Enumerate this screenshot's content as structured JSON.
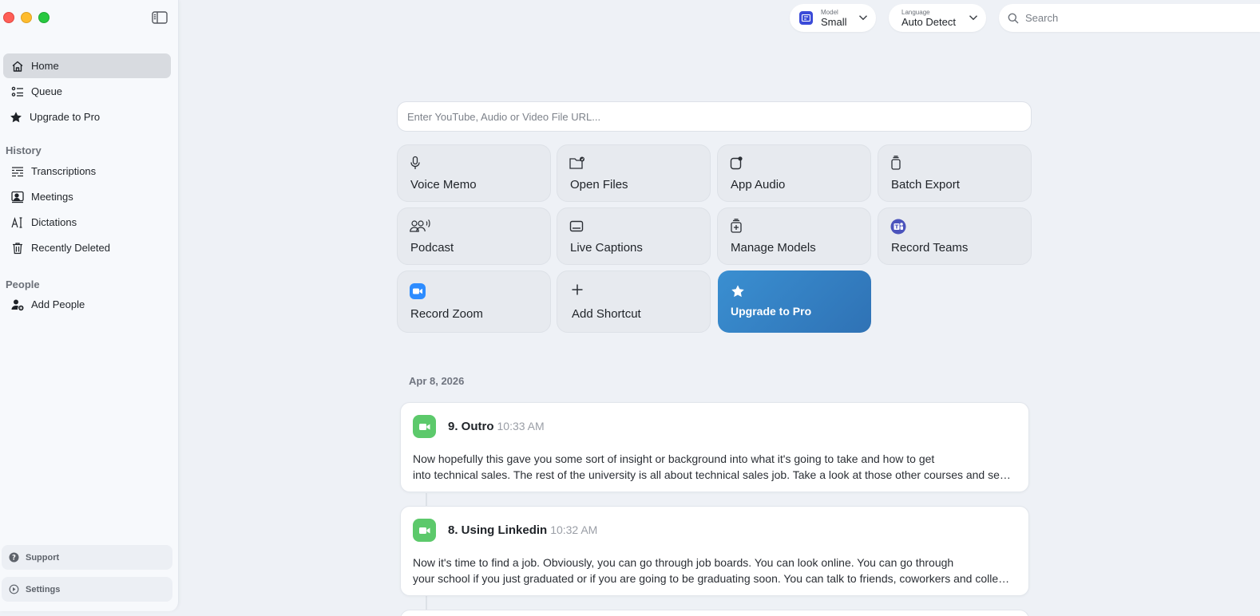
{
  "sidebar": {
    "items": [
      {
        "label": "Home"
      },
      {
        "label": "Queue"
      },
      {
        "label": "Upgrade to Pro"
      }
    ],
    "history_heading": "History",
    "history_items": [
      {
        "label": "Transcriptions"
      },
      {
        "label": "Meetings"
      },
      {
        "label": "Dictations"
      },
      {
        "label": "Recently Deleted"
      }
    ],
    "people_heading": "People",
    "people_items": [
      {
        "label": "Add People"
      }
    ],
    "support_label": "Support",
    "settings_label": "Settings"
  },
  "toolbar": {
    "model_caption": "Model",
    "model_value": "Small",
    "language_caption": "Language",
    "language_value": "Auto Detect",
    "search_placeholder": "Search"
  },
  "main": {
    "url_placeholder": "Enter YouTube, Audio or Video File URL...",
    "tiles": [
      {
        "label": "Voice Memo"
      },
      {
        "label": "Open Files"
      },
      {
        "label": "App Audio"
      },
      {
        "label": "Batch Export"
      },
      {
        "label": "Podcast"
      },
      {
        "label": "Live Captions"
      },
      {
        "label": "Manage Models"
      },
      {
        "label": "Record Teams"
      },
      {
        "label": "Record Zoom"
      },
      {
        "label": "Add Shortcut"
      },
      {
        "label": "Upgrade to Pro"
      }
    ],
    "date_heading": "Apr 8, 2026",
    "cards": [
      {
        "title": "9. Outro",
        "time": "10:33 AM",
        "line1": "Now hopefully this gave you some sort of insight or background into what it's going to take and how to get",
        "line2": "into technical sales. The rest of the university is all about technical sales job. Take a look at those other courses and see what else you can learn."
      },
      {
        "title": "8. Using Linkedin",
        "time": "10:32 AM",
        "line1": "Now it's time to find a job. Obviously, you can go through job boards. You can look online. You can go through",
        "line2": "your school if you just graduated or if you are going to be graduating soon. You can talk to friends, coworkers and colleagues."
      }
    ]
  },
  "colors": {
    "accent": "#2f72b5",
    "meeting_icon": "#5cc96b",
    "model_badge": "#3b4bd8"
  }
}
